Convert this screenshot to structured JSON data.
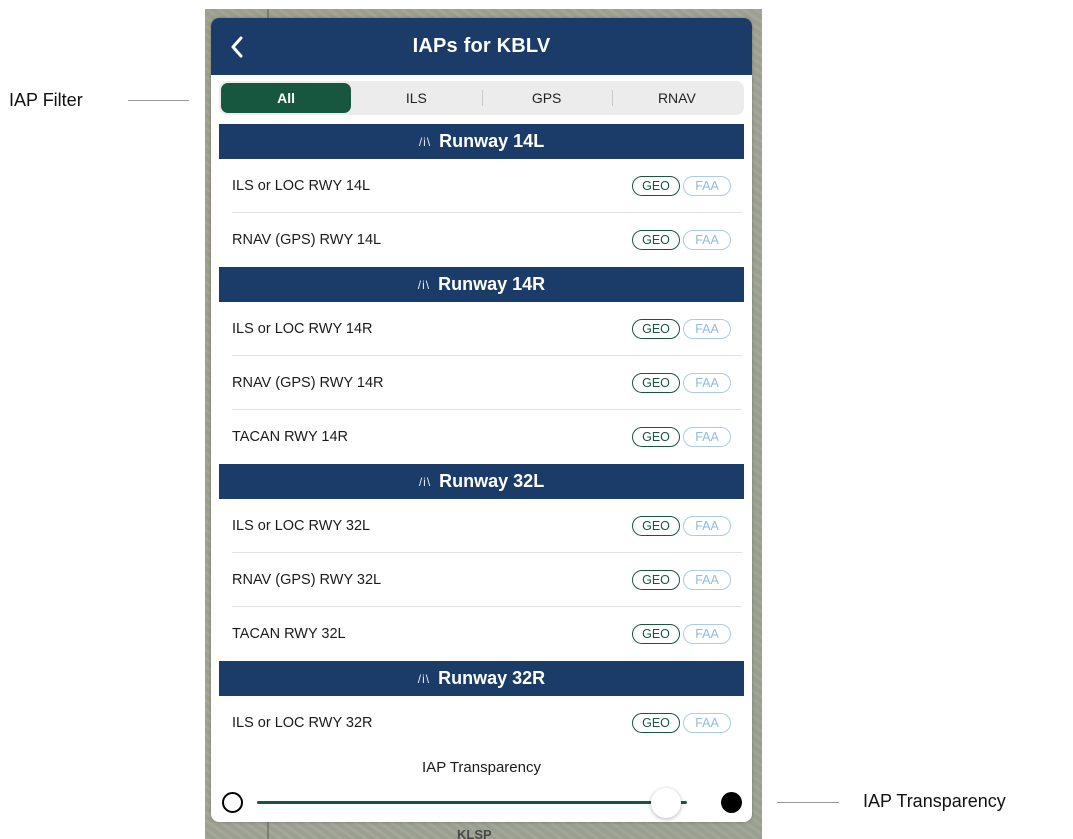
{
  "callouts": {
    "filter_label": "IAP Filter",
    "transparency_label": "IAP Transparency"
  },
  "map": {
    "labels": [
      "KLSP"
    ]
  },
  "header": {
    "title": "IAPs for KBLV",
    "back_icon": "chevron-left-icon"
  },
  "filter": {
    "options": [
      "All",
      "ILS",
      "GPS",
      "RNAV"
    ],
    "selected": "All"
  },
  "sections": [
    {
      "title": "Runway 14L",
      "warning_glyph": "/i\\",
      "approaches": [
        {
          "name": "ILS or LOC RWY 14L",
          "geo": "GEO",
          "faa": "FAA"
        },
        {
          "name": "RNAV (GPS) RWY 14L",
          "geo": "GEO",
          "faa": "FAA"
        }
      ]
    },
    {
      "title": "Runway 14R",
      "warning_glyph": "/i\\",
      "approaches": [
        {
          "name": "ILS or LOC RWY 14R",
          "geo": "GEO",
          "faa": "FAA"
        },
        {
          "name": "RNAV (GPS) RWY 14R",
          "geo": "GEO",
          "faa": "FAA"
        },
        {
          "name": "TACAN RWY 14R",
          "geo": "GEO",
          "faa": "FAA"
        }
      ]
    },
    {
      "title": "Runway 32L",
      "warning_glyph": "/i\\",
      "approaches": [
        {
          "name": "ILS or LOC RWY 32L",
          "geo": "GEO",
          "faa": "FAA"
        },
        {
          "name": "RNAV (GPS) RWY 32L",
          "geo": "GEO",
          "faa": "FAA"
        },
        {
          "name": "TACAN RWY 32L",
          "geo": "GEO",
          "faa": "FAA"
        }
      ]
    },
    {
      "title": "Runway 32R",
      "warning_glyph": "/i\\",
      "approaches": [
        {
          "name": "ILS or LOC RWY 32R",
          "geo": "GEO",
          "faa": "FAA"
        }
      ]
    }
  ],
  "transparency": {
    "label": "IAP Transparency",
    "value_fraction": 0.95,
    "min_icon": "empty-circle-icon",
    "max_icon": "filled-circle-icon"
  },
  "colors": {
    "header_blue": "#1b3b68",
    "accent_green": "#17573f",
    "faa_blue": "#8fbbe0"
  }
}
